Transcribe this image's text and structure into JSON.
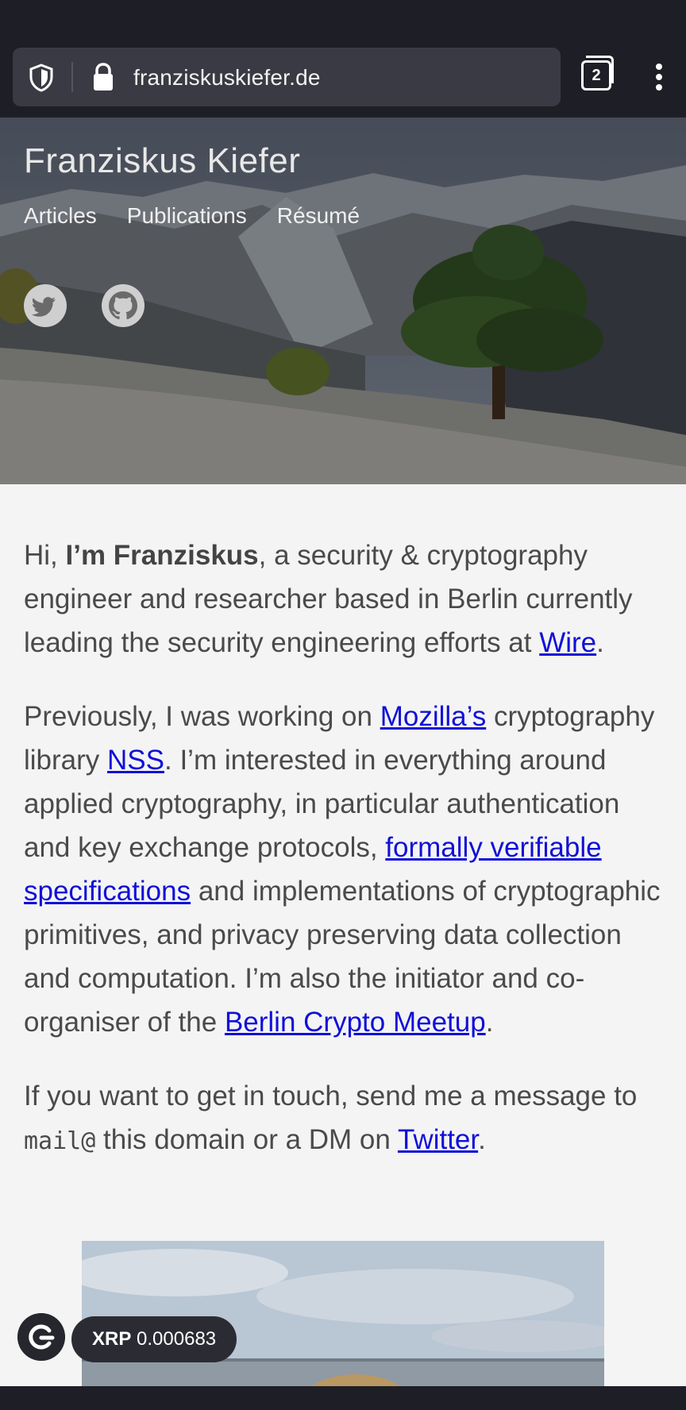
{
  "browser": {
    "url": "franziskuskiefer.de",
    "tab_count": "2"
  },
  "header": {
    "site_title": "Franziskus Kiefer",
    "nav": [
      "Articles",
      "Publications",
      "Résumé"
    ]
  },
  "content": {
    "p1": {
      "pre": "Hi, ",
      "bold": "I’m Franziskus",
      "mid": ", a security & cryptography engineer and researcher based in Berlin currently leading the security engineering efforts at ",
      "link": "Wire",
      "post": "."
    },
    "p2": {
      "t1": "Previously, I was working on ",
      "link1": "Mozilla’s",
      "t2": " cryptography library ",
      "link2": "NSS",
      "t3": ". I’m interested in everything around applied cryptography, in particular authentication and key exchange protocols, ",
      "link3": "formally verifiable specifications",
      "t4": " and implementations of cryptographic primitives, and privacy preserving data collection and computation. I’m also the initiator and co-organiser of the ",
      "link4": "Berlin Crypto Meetup",
      "t5": "."
    },
    "p3": {
      "t1": "If you want to get in touch, send me a message to ",
      "code": "mail@",
      "t2": " this domain or a DM on ",
      "link": "Twitter",
      "t3": "."
    }
  },
  "widget": {
    "ticker": "XRP",
    "price": "0.000683"
  },
  "colors": {
    "chrome": "#1e1e26",
    "link": "#1010d8",
    "text": "#4a4a4a",
    "page_bg": "#f4f4f4"
  }
}
